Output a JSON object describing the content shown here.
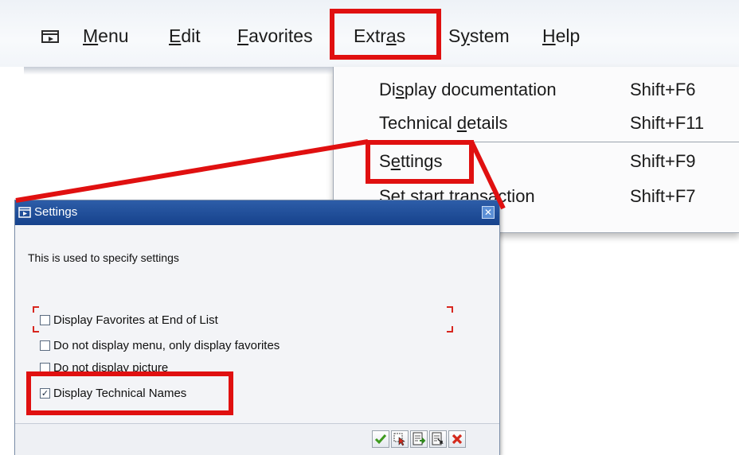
{
  "menubar": {
    "items": [
      {
        "pre": "",
        "u": "M",
        "post": "enu"
      },
      {
        "pre": "",
        "u": "E",
        "post": "dit"
      },
      {
        "pre": "",
        "u": "F",
        "post": "avorites"
      },
      {
        "pre": "Extr",
        "u": "a",
        "post": "s"
      },
      {
        "pre": "S",
        "u": "y",
        "post": "stem"
      },
      {
        "pre": "",
        "u": "H",
        "post": "elp"
      }
    ]
  },
  "dropdown": {
    "items": [
      {
        "pre": "Di",
        "u": "s",
        "post": "play documentation",
        "shortcut": "Shift+F6"
      },
      {
        "pre": "Technical ",
        "u": "d",
        "post": "etails",
        "shortcut": "Shift+F11"
      },
      {
        "pre": "S",
        "u": "e",
        "post": "ttings",
        "shortcut": "Shift+F9"
      },
      {
        "pre": "Set start tra",
        "u": "",
        "post": "nsaction",
        "shortcut": "Shift+F7"
      }
    ]
  },
  "dialog": {
    "title": "Settings",
    "close_glyph": "✕",
    "description": "This is used to specify settings",
    "options": [
      {
        "label": "Display Favorites at End of List",
        "checked": false
      },
      {
        "label": "Do not display menu, only display favorites",
        "checked": false
      },
      {
        "label": "Do not display picture",
        "checked": false
      },
      {
        "label": "Display Technical Names",
        "checked": true
      }
    ],
    "check_glyph": "✓"
  },
  "toolbar": {
    "buttons": [
      {
        "icon": "checkmark-icon"
      },
      {
        "icon": "select-cursor-icon"
      },
      {
        "icon": "document-export-icon"
      },
      {
        "icon": "document-import-icon"
      },
      {
        "icon": "cancel-icon"
      }
    ]
  },
  "colors": {
    "annotation_red": "#e01010",
    "titlebar_blue": "#1f4d99",
    "ok_green": "#3e9a1e",
    "cancel_red": "#d42a1c"
  }
}
